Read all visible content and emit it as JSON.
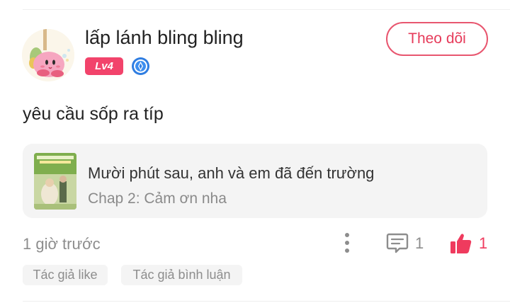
{
  "comment": {
    "user": {
      "name": "lấp lánh bling bling",
      "level": "Lv4"
    },
    "follow_label": "Theo dõi",
    "text": "yêu cầu sốp ra típ",
    "story": {
      "title": "Mười phút sau, anh và em đã đến trường",
      "chapter": "Chap 2: Cảm ơn nha"
    },
    "time": "1 giờ trước",
    "reply_count": "1",
    "like_count": "1",
    "tags": [
      "Tác giả like",
      "Tác giả bình luận"
    ]
  },
  "colors": {
    "accent": "#ef3b5e",
    "level_badge": "#f2436b",
    "card_bg": "#f4f4f4",
    "muted_text": "#8d8d8d"
  },
  "icons": {
    "rank": "rank-badge-icon",
    "more": "more-vertical-icon",
    "reply": "comment-icon",
    "like": "thumbs-up-icon"
  }
}
